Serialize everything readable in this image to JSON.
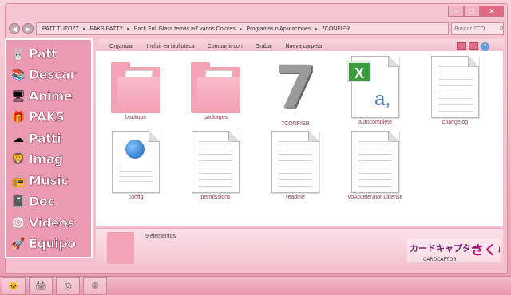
{
  "window": {
    "controls": {
      "minimize": "‒",
      "maximize": "□",
      "close": "✕"
    }
  },
  "address": {
    "back": "◀",
    "forward": "▶",
    "crumbs": [
      "PATT TUTOZZ",
      "PAKS PATTY",
      "Pack Full Glass temas w7 varios Colores",
      "Programas o Aplicaciones",
      "7CONFIER"
    ],
    "search_placeholder": "Buscar 7CO..."
  },
  "toolbar": {
    "organize": "Organizar",
    "include": "Incluir en biblioteca",
    "share": "Compartir con",
    "burn": "Grabar",
    "new_folder": "Nueva carpeta",
    "help": "?"
  },
  "sidebar": {
    "items": [
      {
        "label": "Patt",
        "icon": "bunny-icon",
        "glyph": "🐰"
      },
      {
        "label": "Descar",
        "icon": "book-icon",
        "glyph": "📚"
      },
      {
        "label": "Anime",
        "icon": "monitor-icon",
        "glyph": "🖥"
      },
      {
        "label": "PAKS",
        "icon": "gift-icon",
        "glyph": "🎁"
      },
      {
        "label": "Patti",
        "icon": "ghost-icon",
        "glyph": "☁"
      },
      {
        "label": "Imag",
        "icon": "lion-icon",
        "glyph": "🦁"
      },
      {
        "label": "Music",
        "icon": "radio-icon",
        "glyph": "📻"
      },
      {
        "label": "Doc",
        "icon": "notebook-icon",
        "glyph": "📓"
      },
      {
        "label": "Videos",
        "icon": "roll-icon",
        "glyph": "🍥"
      },
      {
        "label": "Equipo",
        "icon": "rocket-icon",
        "glyph": "🚀"
      }
    ]
  },
  "files": [
    {
      "name": "backups",
      "type": "folder"
    },
    {
      "name": "packages",
      "type": "folder"
    },
    {
      "name": "7CONFIER",
      "type": "app"
    },
    {
      "name": "autocomplete",
      "type": "excel"
    },
    {
      "name": "changelog",
      "type": "doc"
    },
    {
      "name": "config",
      "type": "config"
    },
    {
      "name": "permissions",
      "type": "doc"
    },
    {
      "name": "readme",
      "type": "doc"
    },
    {
      "name": "vbAccelerator License",
      "type": "doc"
    }
  ],
  "status": {
    "count": "9 elementos",
    "logo_text": "カードキャプターさくら",
    "logo_sub": "CARDCAPTOR"
  },
  "colors": {
    "accent": "#ea9ab3",
    "label": "#8a3d52"
  }
}
